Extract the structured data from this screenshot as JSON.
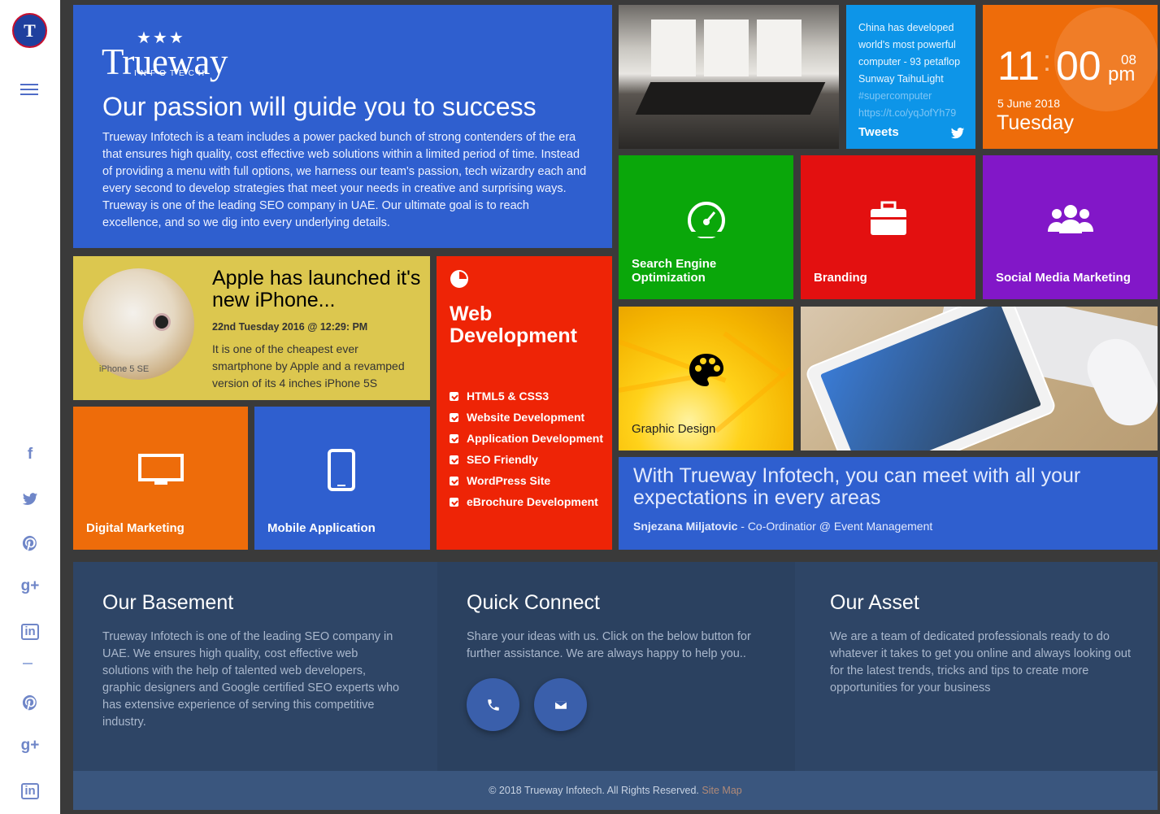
{
  "sidebar": {
    "logo_letter": "T",
    "social": [
      "facebook-icon",
      "twitter-icon",
      "pinterest-icon",
      "google-plus-icon",
      "linkedin-icon",
      "pinterest-icon",
      "google-plus-icon",
      "linkedin-icon"
    ],
    "glyphs": {
      "facebook": "f",
      "googleplus": "g+",
      "linkedin": "in"
    }
  },
  "hero": {
    "logo_name": "Trueway",
    "logo_stars": "★★★",
    "logo_sub": "INFOTECH",
    "title": "Our passion will guide you to success",
    "body": "Trueway Infotech is a team includes a power packed bunch of strong contenders of the era that ensures high quality, cost effective web solutions within a limited period of time. Instead of providing a menu with full options, we harness our team's passion, tech wizardry each and every second to develop strategies that meet your needs in creative and surprising ways. Trueway is one of the leading SEO company in UAE. Our ultimate goal is to reach excellence, and so we dig into every underlying details."
  },
  "tweets": {
    "text": "China has developed world's most powerful computer - 93 petaflop Sunway TaihuLight",
    "tag": "#supercomputer",
    "link": "https://t.co/yqJofYh79",
    "label": "Tweets"
  },
  "clock": {
    "hour": "11",
    "colon": ":",
    "minute": "00",
    "second": "08",
    "ampm": "pm",
    "date": "5 June 2018",
    "day": "Tuesday"
  },
  "tiles": {
    "seo": "Search Engine Optimization",
    "branding": "Branding",
    "social": "Social Media Marketing",
    "graphic": "Graphic Design",
    "digital": "Digital Marketing",
    "mobile": "Mobile Application"
  },
  "apple": {
    "title": "Apple has launched it's new iPhone...",
    "meta": "22nd Tuesday 2016 @ 12:29: PM",
    "desc": "It is one of the cheapest ever smartphone by Apple and a revamped version of its 4 inches iPhone 5S",
    "phone_label": "iPhone 5 SE"
  },
  "webdev": {
    "title": "Web Development",
    "items": [
      "HTML5 & CSS3",
      "Website Development",
      "Application Development",
      "SEO Friendly",
      "WordPress Site",
      "eBrochure Development"
    ]
  },
  "testimonial": {
    "quote": "With Trueway Infotech, you can meet with all your expectations in every areas",
    "author": "Snjezana Miljatovic",
    "role": " - Co-Ordinatior @ Event Management"
  },
  "footer": {
    "basement_title": "Our Basement",
    "basement_text": "Trueway Infotech is one of the leading SEO company in UAE. We ensures high quality, cost effective web solutions with the help of talented web developers, graphic designers and Google certified SEO experts who has extensive experience of serving this competitive industry.",
    "connect_title": "Quick Connect",
    "connect_text": "Share your ideas with us. Click on the below button for further assistance. We are always happy to help you..",
    "asset_title": "Our Asset",
    "asset_text": "We are a team of dedicated professionals ready to do whatever it takes to get you online and always looking out for the latest trends, tricks and tips to create more opportunities for your business",
    "copyright": "© 2018 Trueway Infotech. All Rights Reserved.",
    "sitemap": "Site Map"
  },
  "colors": {
    "blue": "#2f5fcf",
    "orange": "#ee6c0a",
    "green": "#0aa70a",
    "red": "#e31010",
    "purple": "#8217c8",
    "yellow": "#dcc74f",
    "footer": "#2e4566"
  }
}
